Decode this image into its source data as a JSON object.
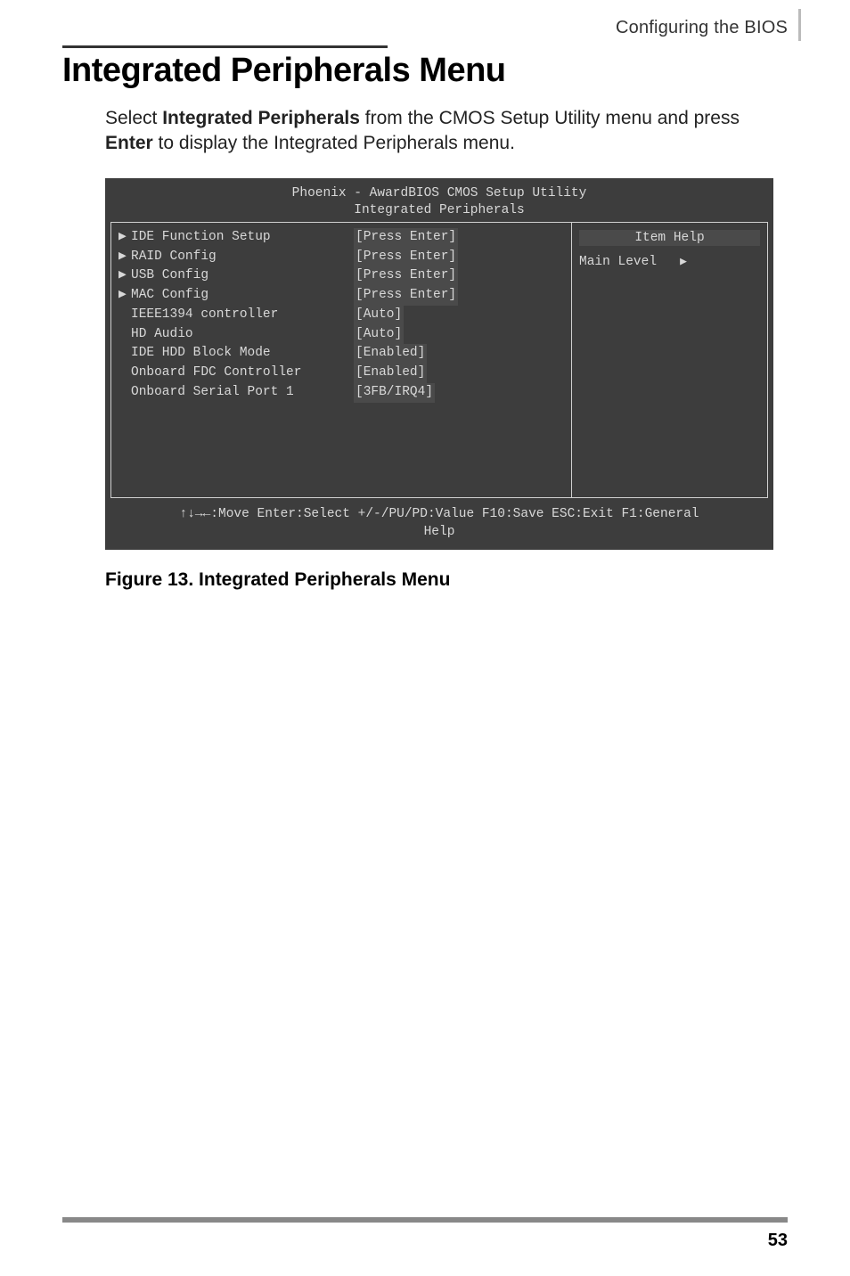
{
  "header": {
    "section": "Configuring the BIOS"
  },
  "title": "Integrated Peripherals Menu",
  "intro": {
    "pre": "Select ",
    "b1": "Integrated Peripherals",
    "mid": " from the CMOS Setup Utility menu and press ",
    "b2": "Enter",
    "post": " to display the Integrated Peripherals menu."
  },
  "bios": {
    "title_line1": "Phoenix - AwardBIOS CMOS Setup Utility",
    "title_line2": "Integrated Peripherals",
    "rows": [
      {
        "tri": "▶",
        "label": "IDE Function Setup",
        "value": "[Press Enter]"
      },
      {
        "tri": "▶",
        "label": "RAID Config",
        "value": "[Press Enter]"
      },
      {
        "tri": "▶",
        "label": "USB Config",
        "value": "[Press Enter]"
      },
      {
        "tri": "▶",
        "label": "MAC Config",
        "value": "[Press Enter]"
      },
      {
        "tri": "",
        "label": "IEEE1394 controller",
        "value": "[Auto]"
      },
      {
        "tri": "",
        "label": "HD Audio",
        "value": "[Auto]"
      },
      {
        "tri": "",
        "label": "IDE HDD Block Mode",
        "value": "[Enabled]"
      },
      {
        "tri": "",
        "label": "Onboard FDC Controller",
        "value": "[Enabled]"
      },
      {
        "tri": "",
        "label": "Onboard Serial Port 1",
        "value": "[3FB/IRQ4]"
      }
    ],
    "help_title": "Item Help",
    "help_level_label": "Main Level",
    "help_level_arrow": "▶",
    "footer_line1": "↑↓→←:Move  Enter:Select  +/-/PU/PD:Value  F10:Save  ESC:Exit  F1:General",
    "footer_line2": "Help"
  },
  "figure_caption": "Figure 13. Integrated Peripherals Menu",
  "page_number": "53"
}
